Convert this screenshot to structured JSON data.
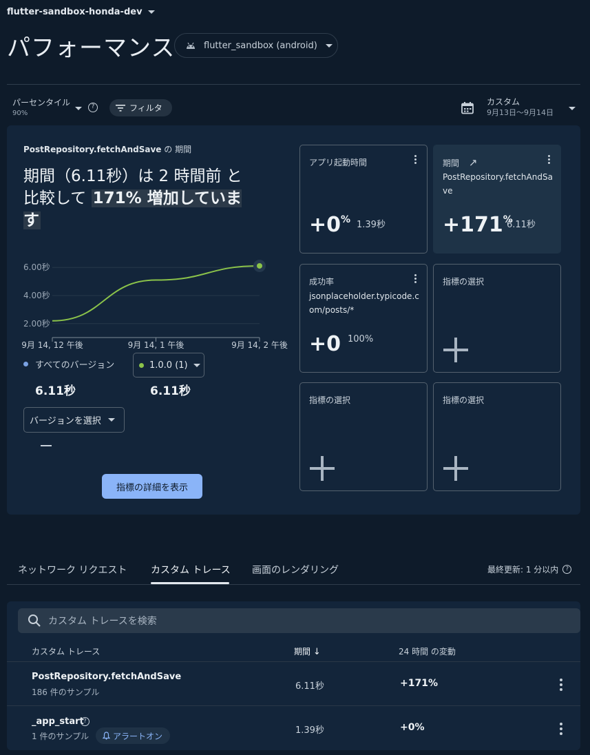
{
  "project": {
    "name": "flutter-sandbox-honda-dev"
  },
  "page": {
    "title": "パフォーマンス"
  },
  "app_select": {
    "label": "flutter_sandbox (android)",
    "icon": "android-icon"
  },
  "toolbar": {
    "percentile_label": "パーセンタイル",
    "percentile_value": "90%",
    "filter_label": "フィルタ",
    "range_label": "カスタム",
    "range_value": "9月13日〜9月14日"
  },
  "metric": {
    "name": "PostRepository.fetchAndSave",
    "head_suffix": "の 期間",
    "headline_plain": "期間（6.11秒）は 2 時間前 と比較して ",
    "headline_highlight": "171% 増加しています"
  },
  "chart_data": {
    "type": "line",
    "x": [
      "9月 14, 12 午後",
      "9月 14, 1 午後",
      "9月 14, 2 午後"
    ],
    "xlabel": "",
    "ylabel": "",
    "yticks": [
      "2.00秒",
      "4.00秒",
      "6.00秒"
    ],
    "ylim": [
      1.5,
      6.5
    ],
    "series": [
      {
        "values": [
          2.2,
          5.1,
          6.11
        ],
        "color": "#8bc34a"
      }
    ],
    "grid": true
  },
  "legend": {
    "all_label": "すべてのバージョン",
    "all_value": "6.11秒",
    "all_color": "#7aa2e3",
    "version_label": "1.0.0 (1)",
    "version_value": "6.11秒",
    "version_color": "#8bc34a",
    "select_label": "バージョンを選択",
    "select_value": "—"
  },
  "details_button": "指標の詳細を表示",
  "cards": {
    "c1": {
      "title": "アプリ起動時間",
      "big": "+0",
      "pct": "%",
      "small": "1.39秒"
    },
    "c2": {
      "title": "期間",
      "sub": "PostRepository.fetchAndSave",
      "big": "+171",
      "pct": "%",
      "small": "6.11秒"
    },
    "c3": {
      "title": "成功率",
      "sub": "jsonplaceholder.typicode.com/posts/*",
      "big": "+0",
      "small": "100%"
    },
    "c4": {
      "title": "指標の選択"
    },
    "c5": {
      "title": "指標の選択"
    },
    "c6": {
      "title": "指標の選択"
    }
  },
  "tabs": [
    "ネットワーク リクエスト",
    "カスタム トレース",
    "画面のレンダリング"
  ],
  "updated": "最終更新: 1 分以内",
  "search": {
    "placeholder": "カスタム トレースを検索"
  },
  "table": {
    "headers": [
      "カスタム トレース",
      "期間",
      "24 時間 の変動"
    ],
    "rows": [
      {
        "name": "PostRepository.fetchAndSave",
        "samples": "186 件のサンプル",
        "duration": "6.11秒",
        "change": "+171%"
      },
      {
        "name": "_app_start",
        "samples": "1 件のサンプル",
        "duration": "1.39秒",
        "change": "+0%",
        "alert": "アラートオン"
      }
    ]
  }
}
